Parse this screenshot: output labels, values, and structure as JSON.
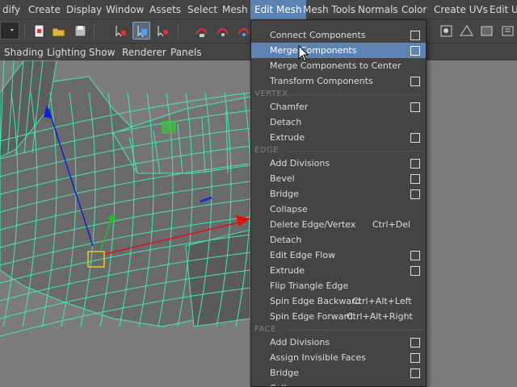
{
  "menubar": {
    "items": [
      {
        "label": "dify"
      },
      {
        "label": "Create"
      },
      {
        "label": "Display"
      },
      {
        "label": "Window"
      },
      {
        "label": "Assets"
      },
      {
        "label": "Select"
      },
      {
        "label": "Mesh"
      },
      {
        "label": "Edit Mesh"
      },
      {
        "label": "Mesh Tools"
      },
      {
        "label": "Normals"
      },
      {
        "label": "Color"
      },
      {
        "label": "Create UVs"
      },
      {
        "label": "Edit UV"
      }
    ],
    "active_index": 7
  },
  "panel_menu": {
    "items": [
      "Shading",
      "Lighting",
      "Show",
      "Renderer",
      "Panels"
    ]
  },
  "edit_mesh_menu": {
    "rows": [
      {
        "label": "Connect Components",
        "option_box": true
      },
      {
        "label": "Merge Components",
        "option_box": true,
        "highlighted": true
      },
      {
        "label": "Merge Components to Center"
      },
      {
        "label": "Transform Components",
        "option_box": true
      },
      {
        "section": "VERTEX"
      },
      {
        "label": "Chamfer",
        "option_box": true
      },
      {
        "label": "Detach"
      },
      {
        "label": "Extrude",
        "option_box": true
      },
      {
        "section": "EDGE"
      },
      {
        "label": "Add Divisions",
        "option_box": true
      },
      {
        "label": "Bevel",
        "option_box": true
      },
      {
        "label": "Bridge",
        "option_box": true
      },
      {
        "label": "Collapse"
      },
      {
        "label": "Delete Edge/Vertex",
        "shortcut": "Ctrl+Del"
      },
      {
        "label": "Detach"
      },
      {
        "label": "Edit Edge Flow",
        "option_box": true
      },
      {
        "label": "Extrude",
        "option_box": true
      },
      {
        "label": "Flip Triangle Edge"
      },
      {
        "label": "Spin Edge Backward",
        "shortcut": "Ctrl+Alt+Left"
      },
      {
        "label": "Spin Edge Forward",
        "shortcut": "Ctrl+Alt+Right"
      },
      {
        "section": "FACE"
      },
      {
        "label": "Add Divisions",
        "option_box": true
      },
      {
        "label": "Assign Invisible Faces",
        "option_box": true
      },
      {
        "label": "Bridge",
        "option_box": true
      },
      {
        "label": "Collapse"
      }
    ]
  },
  "toolbar": {
    "icons": [
      "mode-dropdown-icon",
      "new-scene-icon",
      "open-scene-icon",
      "save-scene-icon",
      "select-hierarchy-icon",
      "select-object-icon",
      "select-component-icon",
      "snap-grid-icon",
      "snap-curve-icon",
      "snap-point-icon",
      "snap-view-plane-icon",
      "snap-live-icon",
      "render-icon",
      "ipr-render-icon",
      "render-settings-icon",
      "hypershade-icon"
    ]
  },
  "viewport": {
    "wireframe_color": "#44e8b0",
    "mesh_color": "#6a6a6a",
    "axis_colors": {
      "x": "#e01010",
      "y": "#20c020",
      "z": "#1020d0"
    },
    "pivot_color": "#e0d020"
  },
  "colors": {
    "accent": "#5c83b3",
    "menu_bg": "#444444",
    "viewport_bg": "#7c7c7c"
  }
}
